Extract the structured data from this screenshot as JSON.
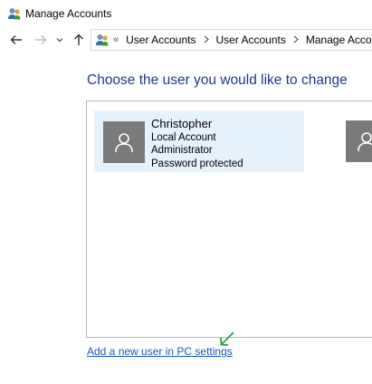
{
  "window": {
    "title": "Manage Accounts",
    "icon": "user-accounts-icon"
  },
  "navigation": {
    "back_icon": "arrow-left-icon",
    "forward_icon": "arrow-right-icon",
    "recent_icon": "chevron-down-icon",
    "up_icon": "arrow-up-icon"
  },
  "address_bar": {
    "overflow": "«",
    "breadcrumbs": [
      "User Accounts",
      "User Accounts",
      "Manage Accounts"
    ],
    "separator": ">"
  },
  "main": {
    "heading": "Choose the user you would like to change",
    "accounts": [
      {
        "name": "Christopher",
        "details": [
          "Local Account",
          "Administrator",
          "Password protected"
        ],
        "selected": true
      }
    ],
    "add_user_link": "Add a new user in PC settings"
  },
  "colors": {
    "heading": "#1e3a8a",
    "link": "#1a56c4",
    "tile_highlight": "#e5f1fb",
    "avatar_bg": "#7a7a7a",
    "annotation_arrow": "#2ea043"
  }
}
